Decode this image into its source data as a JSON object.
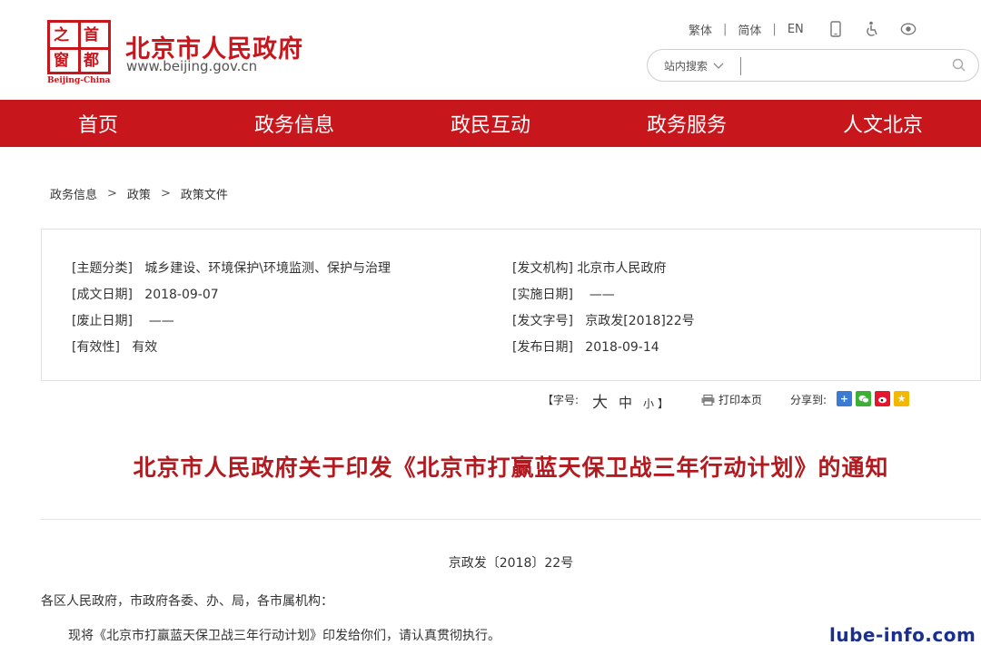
{
  "header": {
    "logo_chars": [
      "之",
      "首",
      "窗",
      "都"
    ],
    "logo_en": "Beijing-China",
    "title": "北京市人民政府",
    "url": "www.beijing.gov.cn",
    "top_links": [
      "繁体",
      "简体",
      "EN"
    ],
    "icons": [
      "mobile-icon",
      "accessibility-icon",
      "elderly-care-icon"
    ],
    "search": {
      "scope": "站内搜索",
      "placeholder": "",
      "value": ""
    },
    "accent_color": "#c8161d"
  },
  "nav": {
    "items": [
      "首页",
      "政务信息",
      "政民互动",
      "政务服务",
      "人文北京"
    ]
  },
  "breadcrumb": [
    "政务信息",
    "政策",
    "政策文件"
  ],
  "meta": {
    "left": [
      {
        "label": "[主题分类]",
        "value": "城乡建设、环境保护\\环境监测、保护与治理"
      },
      {
        "label": "[成文日期]",
        "value": "2018-09-07"
      },
      {
        "label": "[废止日期]",
        "value": "——"
      },
      {
        "label": "[有效性]",
        "value": "有效"
      }
    ],
    "right": [
      {
        "label": "[发文机构]",
        "value": "北京市人民政府"
      },
      {
        "label": "[实施日期]",
        "value": "——"
      },
      {
        "label": "[发文字号]",
        "value": "京政发[2018]22号"
      },
      {
        "label": "[发布日期]",
        "value": "2018-09-14"
      }
    ]
  },
  "tools": {
    "font_size_label": "【字号:",
    "sizes": [
      "大",
      "中",
      "小"
    ],
    "font_size_end": "】",
    "print_label": "打印本页",
    "share_label": "分享到:",
    "share_icons": [
      {
        "name": "share-plus-icon",
        "color": "#3a7bd5",
        "glyph": "+"
      },
      {
        "name": "share-wechat-icon",
        "color": "#3cb034",
        "glyph": "✉"
      },
      {
        "name": "share-weibo-icon",
        "color": "#e6162d",
        "glyph": "微"
      },
      {
        "name": "share-qzone-icon",
        "color": "#f5b800",
        "glyph": "★"
      }
    ]
  },
  "document": {
    "title": "北京市人民政府关于印发《北京市打赢蓝天保卫战三年行动计划》的通知",
    "number": "京政发〔2018〕22号",
    "salutation": "各区人民政府，市政府各委、办、局，各市属机构：",
    "body": "现将《北京市打赢蓝天保卫战三年行动计划》印发给你们，请认真贯彻执行。"
  },
  "watermark": "lube-info.com"
}
